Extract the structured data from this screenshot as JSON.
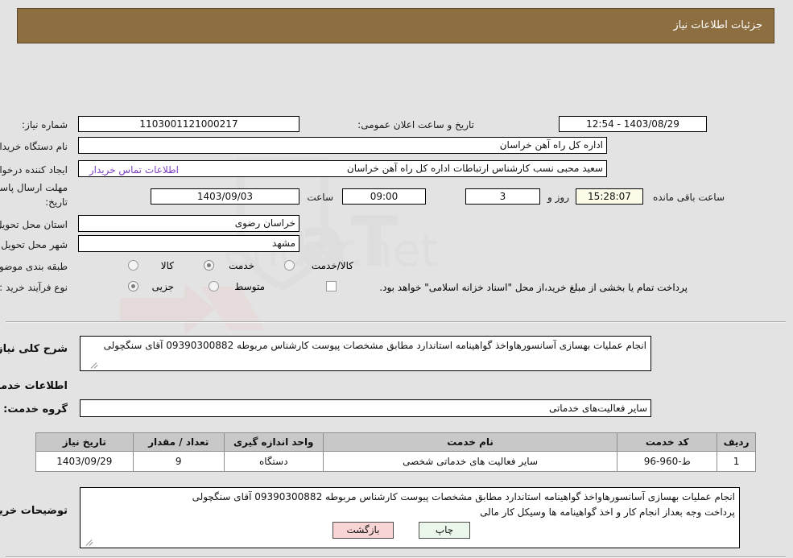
{
  "header": {
    "title": "جزئیات اطلاعات نیاز"
  },
  "fields": {
    "need_number_label": "شماره نیاز:",
    "need_number_value": "1103001121000217",
    "public_announce_label": "تاریخ و ساعت اعلان عمومی:",
    "public_announce_value": "1403/08/29 - 12:54",
    "buyer_org_label": "نام دستگاه خریدار:",
    "buyer_org_value": "اداره کل راه آهن خراسان",
    "requester_label": "ایجاد کننده درخواست:",
    "requester_value": "سعید محبی نسب کارشناس ارتباطات اداره کل راه آهن خراسان",
    "contact_link": "اطلاعات تماس خریدار",
    "deadline_label_line1": "مهلت ارسال پاسخ: تا",
    "deadline_label_line2": "تاریخ:",
    "deadline_date": "1403/09/03",
    "hour_label": "ساعت",
    "hour_value": "09:00",
    "days_value": "3",
    "days_and_label": "روز و",
    "remaining_time": "15:28:07",
    "remaining_label": "ساعت باقی مانده",
    "province_label": "استان محل تحویل:",
    "province_value": "خراسان رضوی",
    "city_label": "شهر محل تحویل:",
    "city_value": "مشهد",
    "category_label": "طبقه بندی موضوعی:",
    "process_label": "نوع فرآیند خرید :",
    "treasury_note": "پرداخت تمام یا بخشی از مبلغ خرید،از محل \"اسناد خزانه اسلامی\" خواهد بود."
  },
  "category_options": [
    {
      "label": "کالا",
      "selected": false
    },
    {
      "label": "خدمت",
      "selected": true
    },
    {
      "label": "کالا/خدمت",
      "selected": false
    }
  ],
  "process_options": [
    {
      "label": "جزیی",
      "selected": true
    },
    {
      "label": "متوسط",
      "selected": false
    }
  ],
  "summary": {
    "label": "شرح کلی نیاز:",
    "value": "انجام عملیات بهسازی آسانسورهاواخذ گواهینامه استاندارد مطابق مشخصات پیوست کارشناس مربوطه 09390300882 آقای سنگچولی"
  },
  "services_section": {
    "heading": "اطلاعات خدمات مورد نیاز",
    "group_label": "گروه خدمت:",
    "group_value": "سایر فعالیت‌های خدماتی"
  },
  "table": {
    "columns": [
      "ردیف",
      "کد خدمت",
      "نام خدمت",
      "واحد اندازه گیری",
      "تعداد / مقدار",
      "تاریخ نیاز"
    ],
    "rows": [
      {
        "row": "1",
        "code": "ط-960-96",
        "name": "سایر فعالیت های خدماتی شخصی",
        "unit": "دستگاه",
        "qty": "9",
        "date": "1403/09/29"
      }
    ]
  },
  "buyer_notes": {
    "label": "توضیحات خریدار:",
    "value": "انجام عملیات بهسازی آسانسورهاواخذ گواهینامه استاندارد مطابق مشخصات پیوست کارشناس مربوطه 09390300882 آقای سنگچولی\nپرداخت وجه بعداز انجام کار و اخذ گواهینامه ها وسیکل کار مالی"
  },
  "buttons": {
    "print": "چاپ",
    "back": "بازگشت"
  },
  "colors": {
    "header_bar": "#8d6e41",
    "link": "#7a3fbf",
    "print_button": "#eaf7ea",
    "back_button": "#f9d4d4",
    "table_header": "#c8c8c8",
    "page_bg": "#e3e3e3"
  }
}
